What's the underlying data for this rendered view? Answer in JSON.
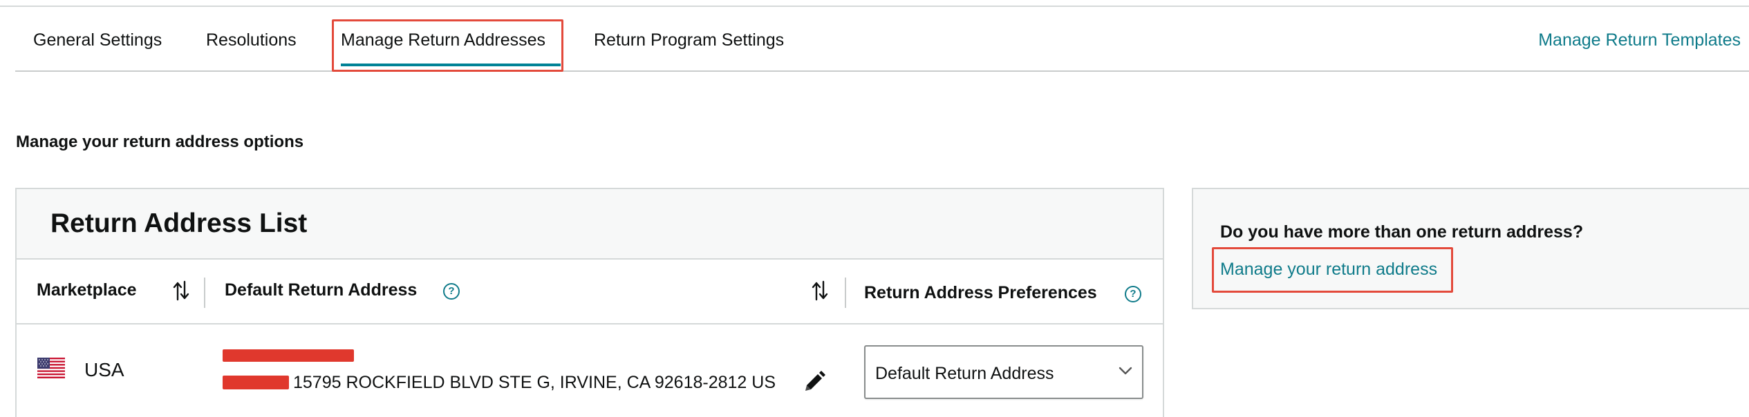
{
  "tabs": {
    "general": "General Settings",
    "resolutions": "Resolutions",
    "manage_addresses": "Manage Return Addresses",
    "program": "Return Program Settings"
  },
  "templates_link": "Manage Return Templates",
  "subtitle": "Manage your return address options",
  "card": {
    "title": "Return Address List",
    "columns": {
      "marketplace": "Marketplace",
      "default_address": "Default Return Address",
      "preferences": "Return Address Preferences"
    },
    "rows": [
      {
        "country": "USA",
        "address": "15795 ROCKFIELD BLVD STE G, IRVINE, CA 92618-2812 US",
        "preference": "Default Return Address"
      }
    ]
  },
  "side": {
    "question": "Do you have more than one return address?",
    "link": "Manage your return address"
  },
  "colors": {
    "accent": "#008296",
    "link": "#0f7b8a",
    "highlight": "#e34a3b",
    "redaction": "#e0382d"
  }
}
